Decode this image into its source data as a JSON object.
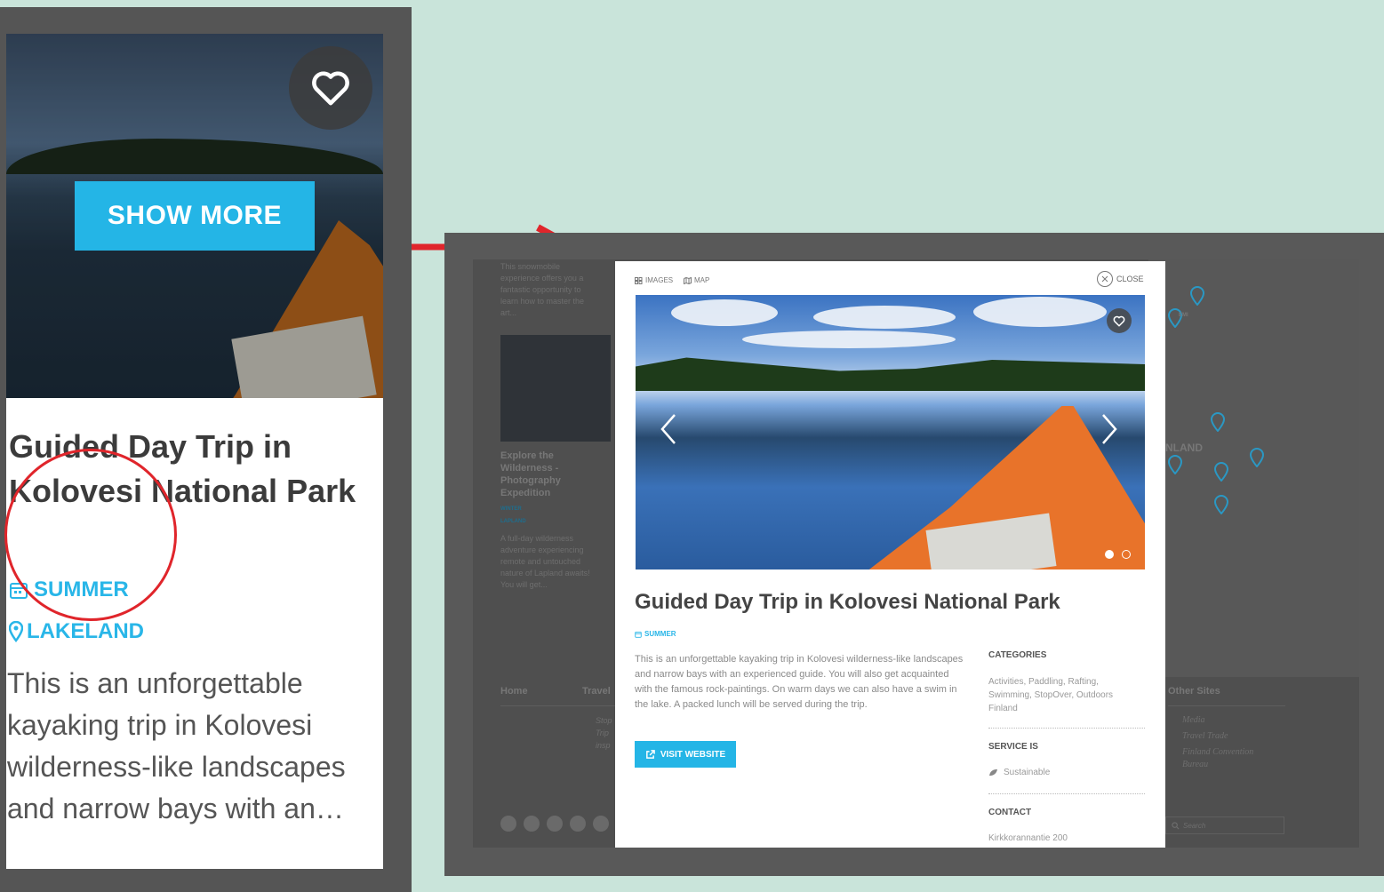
{
  "colors": {
    "accent": "#24b5e6",
    "highlight_red": "#e0252b",
    "backdrop": "#c9e4da"
  },
  "left_card": {
    "show_more_label": "SHOW MORE",
    "title": "Guided Day Trip in Kolovesi National Park",
    "season": "SUMMER",
    "region": "LAKELAND",
    "description": "This is an unforgettable kayaking trip in Kolovesi wilderness-like landscapes and narrow bays with an…",
    "favorite_icon": "heart-icon",
    "season_icon": "calendar-icon",
    "region_icon": "map-pin-icon"
  },
  "background_page": {
    "snippet_top": "This snowmobile experience offers you a fantastic opportunity to learn how to master the art...",
    "card_title": "Explore the Wilderness - Photography Expedition",
    "card_season": "WINTER",
    "card_region": "LAPLAND",
    "card_desc": "A full-day wilderness adventure experiencing remote and untouched nature of Lapland awaits! You will get...",
    "footer_home": "Home",
    "footer_travel": "Travel",
    "footer_links_left": [
      "Stop",
      "Trip",
      "insp"
    ],
    "footer_other_sites": "Other Sites",
    "footer_links_right": [
      "Media",
      "Travel Trade",
      "Finland Convention Bureau"
    ],
    "map_label_finland": "NLAND",
    "map_label_kemi": "EMI",
    "search_placeholder": "Search"
  },
  "modal": {
    "tab_images": "IMAGES",
    "tab_map": "MAP",
    "close_label": "CLOSE",
    "title": "Guided Day Trip in Kolovesi National Park",
    "season": "SUMMER",
    "description": "This is an unforgettable kayaking trip in Kolovesi wilderness-like landscapes and narrow bays with an experienced guide. You will also get acquainted with the famous rock-paintings. On warm days we can also have a swim in the lake. A packed lunch will be served during the trip.",
    "visit_label": "VISIT WEBSITE",
    "categories_heading": "CATEGORIES",
    "categories_text": "Activities, Paddling, Rafting, Swimming, StopOver, Outdoors Finland",
    "service_heading": "SERVICE IS",
    "service_text": "Sustainable",
    "contact_heading": "CONTACT",
    "contact_text": "Kirkkorannantie 200",
    "carousel_slide": 1,
    "carousel_total": 2
  }
}
